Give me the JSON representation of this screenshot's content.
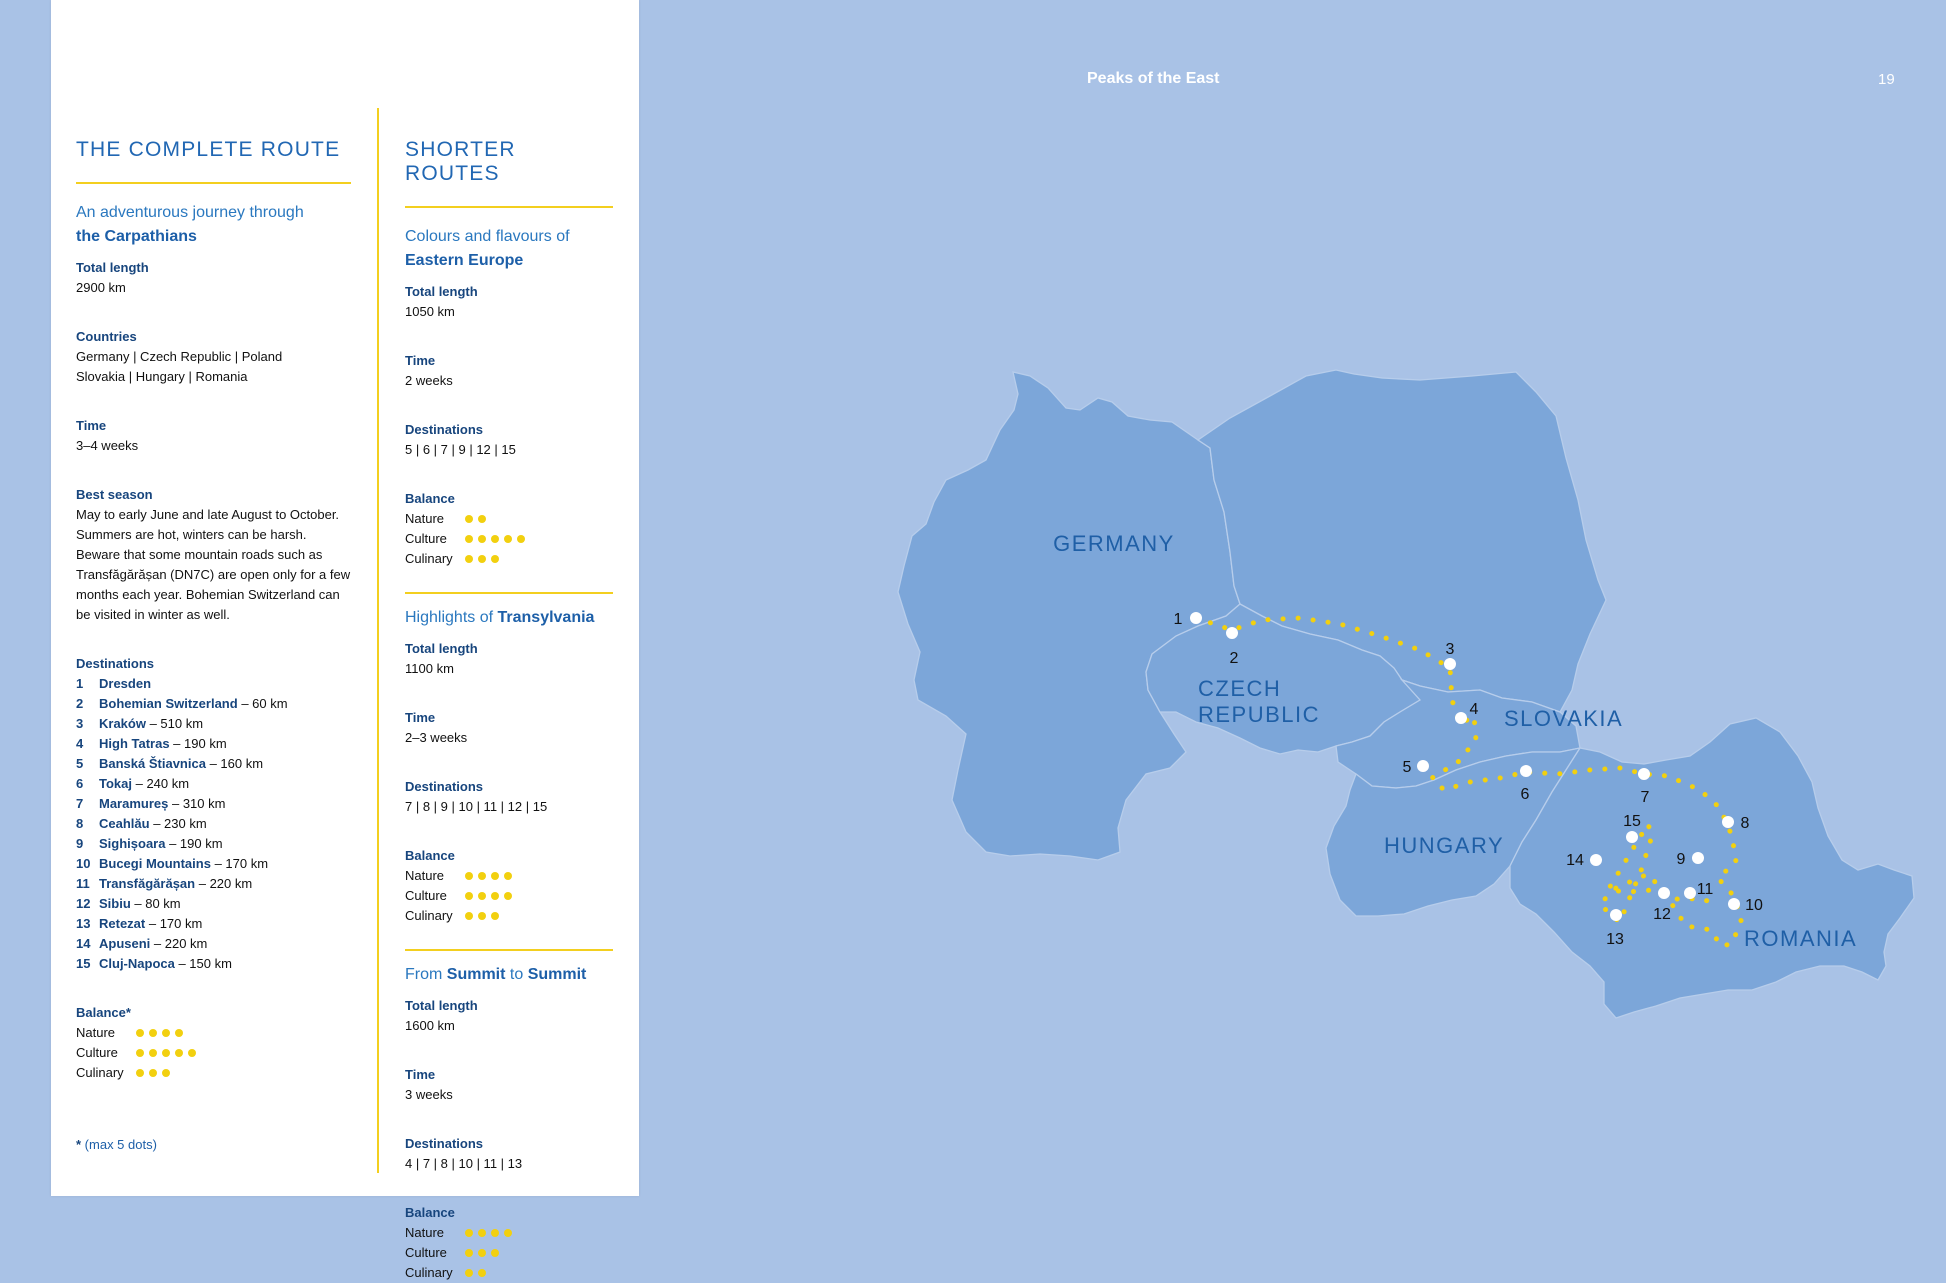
{
  "header": {
    "title": "Peaks of the East",
    "page_number": "19"
  },
  "left": {
    "heading": "THE COMPLETE ROUTE",
    "subtitle_line1": "An adventurous journey through",
    "subtitle_line2": "the Carpathians",
    "total_length_label": "Total length",
    "total_length": "2900 km",
    "countries_label": "Countries",
    "countries_line1": "Germany | Czech Republic | Poland",
    "countries_line2": "Slovakia | Hungary | Romania",
    "time_label": "Time",
    "time": "3–4 weeks",
    "season_label": "Best season",
    "season_text": "May to early June and late August to October. Summers are hot, winters can be harsh. Beware that some mountain roads such as Transfăgărășan (DN7C) are open only for a few months each year. Bohemian Switzerland can be visited in winter as well.",
    "destinations_label": "Destinations",
    "destinations": [
      {
        "num": "1",
        "name": "Dresden",
        "dist": ""
      },
      {
        "num": "2",
        "name": "Bohemian Switzerland",
        "dist": " – 60 km"
      },
      {
        "num": "3",
        "name": "Kraków",
        "dist": " – 510 km"
      },
      {
        "num": "4",
        "name": "High Tatras",
        "dist": " – 190 km"
      },
      {
        "num": "5",
        "name": "Banská Štiavnica",
        "dist": " – 160 km"
      },
      {
        "num": "6",
        "name": "Tokaj",
        "dist": " – 240 km"
      },
      {
        "num": "7",
        "name": "Maramureș",
        "dist": " – 310 km"
      },
      {
        "num": "8",
        "name": "Ceahlău",
        "dist": " – 230 km"
      },
      {
        "num": "9",
        "name": "Sighișoara",
        "dist": " – 190 km"
      },
      {
        "num": "10",
        "name": "Bucegi Mountains",
        "dist": " – 170 km"
      },
      {
        "num": "11",
        "name": "Transfăgărășan",
        "dist": " – 220 km"
      },
      {
        "num": "12",
        "name": "Sibiu",
        "dist": " – 80 km"
      },
      {
        "num": "13",
        "name": "Retezat",
        "dist": " – 170 km"
      },
      {
        "num": "14",
        "name": "Apuseni",
        "dist": " – 220 km"
      },
      {
        "num": "15",
        "name": "Cluj-Napoca",
        "dist": " – 150 km"
      }
    ],
    "balance_label": "Balance*",
    "balance": [
      {
        "label": "Nature",
        "dots": 4
      },
      {
        "label": "Culture",
        "dots": 5
      },
      {
        "label": "Culinary",
        "dots": 3
      }
    ],
    "note_star": "*",
    "note_text": " (max 5 dots)"
  },
  "right": {
    "heading": "SHORTER ROUTES",
    "routes": [
      {
        "title_pre": "Colours and flavours of",
        "title_bold": "Eastern Europe",
        "total_length_label": "Total length",
        "total_length": "1050 km",
        "time_label": "Time",
        "time": "2 weeks",
        "destinations_label": "Destinations",
        "destinations": "5 | 6 | 7 | 9 | 12 | 15",
        "balance_label": "Balance",
        "balance": [
          {
            "label": "Nature",
            "dots": 2
          },
          {
            "label": "Culture",
            "dots": 5
          },
          {
            "label": "Culinary",
            "dots": 3
          }
        ]
      },
      {
        "title_pre": "Highlights of ",
        "title_bold": "Transylvania",
        "total_length_label": "Total length",
        "total_length": "1100 km",
        "time_label": "Time",
        "time": "2–3 weeks",
        "destinations_label": "Destinations",
        "destinations": "7 | 8 | 9 | 10 | 11 | 12 | 15",
        "balance_label": "Balance",
        "balance": [
          {
            "label": "Nature",
            "dots": 4
          },
          {
            "label": "Culture",
            "dots": 4
          },
          {
            "label": "Culinary",
            "dots": 3
          }
        ]
      },
      {
        "title_pre": "From ",
        "title_bold": "Summit",
        "title_mid": " to ",
        "title_bold2": "Summit",
        "total_length_label": "Total length",
        "total_length": "1600 km",
        "time_label": "Time",
        "time": "3 weeks",
        "destinations_label": "Destinations",
        "destinations": "4 | 7 | 8 | 10 | 11 | 13",
        "balance_label": "Balance",
        "balance": [
          {
            "label": "Nature",
            "dots": 4
          },
          {
            "label": "Culture",
            "dots": 3
          },
          {
            "label": "Culinary",
            "dots": 2
          }
        ]
      }
    ]
  },
  "map": {
    "countries": [
      "GERMANY",
      "CZECH",
      "REPUBLIC",
      "SLOVAKIA",
      "HUNGARY",
      "ROMANIA"
    ],
    "stops": [
      "1",
      "2",
      "3",
      "4",
      "5",
      "6",
      "7",
      "8",
      "9",
      "10",
      "11",
      "12",
      "13",
      "14",
      "15"
    ],
    "colors": {
      "land": "#7ca6d9",
      "sea": "#a9c2e6",
      "route": "#f2d00f",
      "label": "#1f5fa6",
      "accent": "#f3cf1f"
    }
  }
}
